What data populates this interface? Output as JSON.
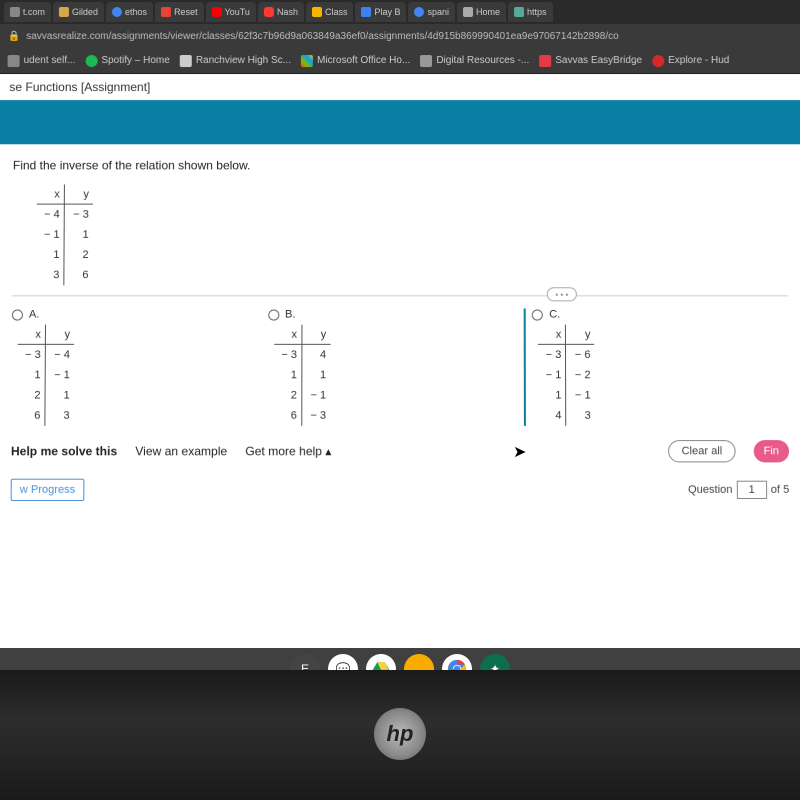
{
  "browser": {
    "tabs": [
      "t.com",
      "Gilded",
      "ethos",
      "Reset",
      "YouTu",
      "Nash",
      "Class",
      "Play B",
      "spani",
      "Home",
      "https"
    ],
    "url": "savvasrealize.com/assignments/viewer/classes/62f3c7b96d9a063849a36ef0/assignments/4d915b869990401ea9e97067142b2898/co",
    "bookmarks": [
      "udent self...",
      "Spotify – Home",
      "Ranchview High Sc...",
      "Microsoft Office Ho...",
      "Digital Resources -...",
      "Savvas EasyBridge",
      "Explore - Hud"
    ]
  },
  "page": {
    "title": "se Functions [Assignment]",
    "prompt": "Find the inverse of the relation shown below.",
    "given": {
      "head": [
        "x",
        "y"
      ],
      "rows": [
        [
          "− 4",
          "− 3"
        ],
        [
          "− 1",
          "1"
        ],
        [
          "1",
          "2"
        ],
        [
          "3",
          "6"
        ]
      ]
    },
    "more": "• • •",
    "options": {
      "a": {
        "label": "A.",
        "head": [
          "x",
          "y"
        ],
        "rows": [
          [
            "− 3",
            "− 4"
          ],
          [
            "1",
            "− 1"
          ],
          [
            "2",
            "1"
          ],
          [
            "6",
            "3"
          ]
        ]
      },
      "b": {
        "label": "B.",
        "head": [
          "x",
          "y"
        ],
        "rows": [
          [
            "− 3",
            "4"
          ],
          [
            "1",
            "1"
          ],
          [
            "2",
            "− 1"
          ],
          [
            "6",
            "− 3"
          ]
        ]
      },
      "c": {
        "label": "C.",
        "head": [
          "x",
          "y"
        ],
        "rows": [
          [
            "− 3",
            "− 6"
          ],
          [
            "− 1",
            "− 2"
          ],
          [
            "1",
            "− 1"
          ],
          [
            "4",
            "3"
          ]
        ]
      }
    },
    "help": {
      "solve": "Help me solve this",
      "example": "View an example",
      "more": "Get more help ▴",
      "clear": "Clear all",
      "finish": "Fin"
    },
    "footer": {
      "progress": "w Progress",
      "question_label": "Question",
      "question_num": "1",
      "of": "of 5"
    }
  },
  "shelf": {
    "e": "E"
  },
  "logo": "hp"
}
